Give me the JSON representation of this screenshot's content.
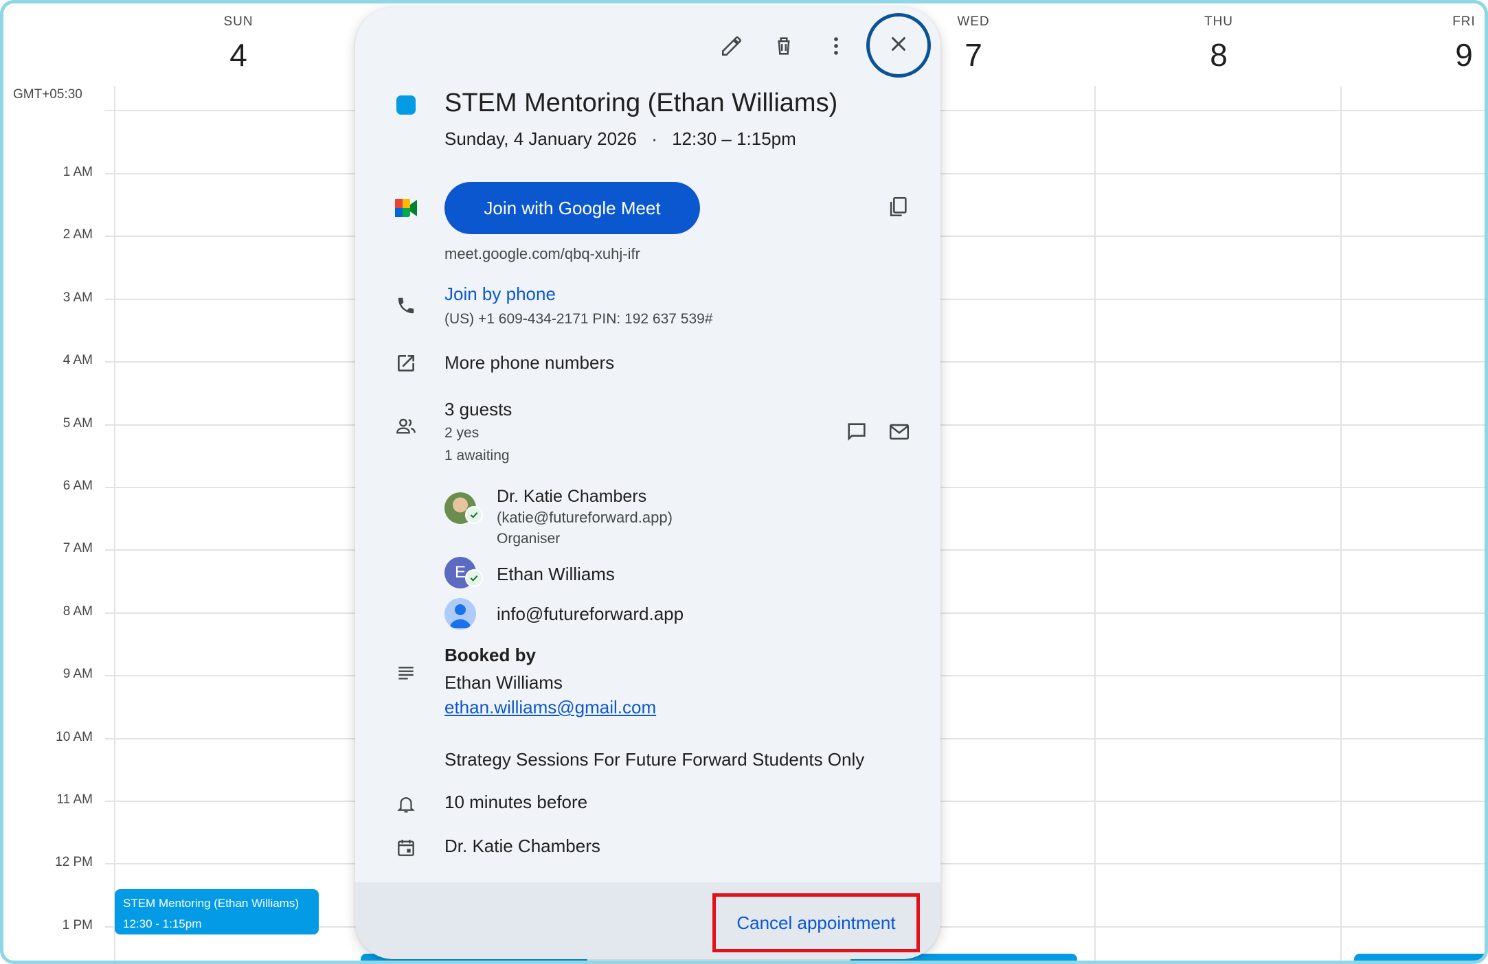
{
  "calendar": {
    "timezone": "GMT+05:30",
    "days": [
      {
        "name": "SUN",
        "num": "4"
      },
      {
        "name": "WED",
        "num": "7"
      },
      {
        "name": "THU",
        "num": "8"
      },
      {
        "name": "FRI",
        "num": "9"
      }
    ],
    "hours": [
      "1 AM",
      "2 AM",
      "3 AM",
      "4 AM",
      "5 AM",
      "6 AM",
      "7 AM",
      "8 AM",
      "9 AM",
      "10 AM",
      "11 AM",
      "12 PM",
      "1 PM"
    ],
    "event_chip": {
      "title": "STEM Mentoring (Ethan Williams)",
      "time": "12:30 - 1:15pm",
      "color": "#039be5"
    }
  },
  "popover": {
    "title": "STEM Mentoring (Ethan Williams)",
    "date": "Sunday, 4 January 2026",
    "time": "12:30 – 1:15pm",
    "separator": "·",
    "meet_button": "Join with Google Meet",
    "meet_link": "meet.google.com/qbq-xuhj-ifr",
    "phone_link": "Join by phone",
    "phone_details": "(US) +1 609-434-2171 PIN: 192 637 539#",
    "more_phone": "More phone numbers",
    "guests": {
      "count": "3 guests",
      "yes": "2 yes",
      "awaiting": "1 awaiting",
      "list": [
        {
          "name": "Dr. Katie Chambers",
          "email": "(katie@futureforward.app)",
          "role": "Organiser"
        },
        {
          "name": "Ethan Williams",
          "initial": "E"
        },
        {
          "name": "info@futureforward.app"
        }
      ]
    },
    "booked_by_heading": "Booked by",
    "booked_by_name": "Ethan Williams",
    "booked_by_email": "ethan.williams@gmail.com",
    "description": "Strategy Sessions For Future Forward Students Only",
    "reminder": "10 minutes before",
    "calendar_owner": "Dr. Katie Chambers",
    "cancel_button": "Cancel appointment"
  },
  "colors": {
    "accent": "#0b57d0",
    "event": "#039be5",
    "highlight_border": "#e0121b",
    "close_ring": "#0b5394"
  },
  "icons": [
    "edit-icon",
    "delete-icon",
    "more-icon",
    "close-icon",
    "google-meet-icon",
    "copy-icon",
    "phone-icon",
    "open-external-icon",
    "people-icon",
    "chat-icon",
    "email-icon",
    "description-icon",
    "bell-icon",
    "calendar-icon"
  ]
}
